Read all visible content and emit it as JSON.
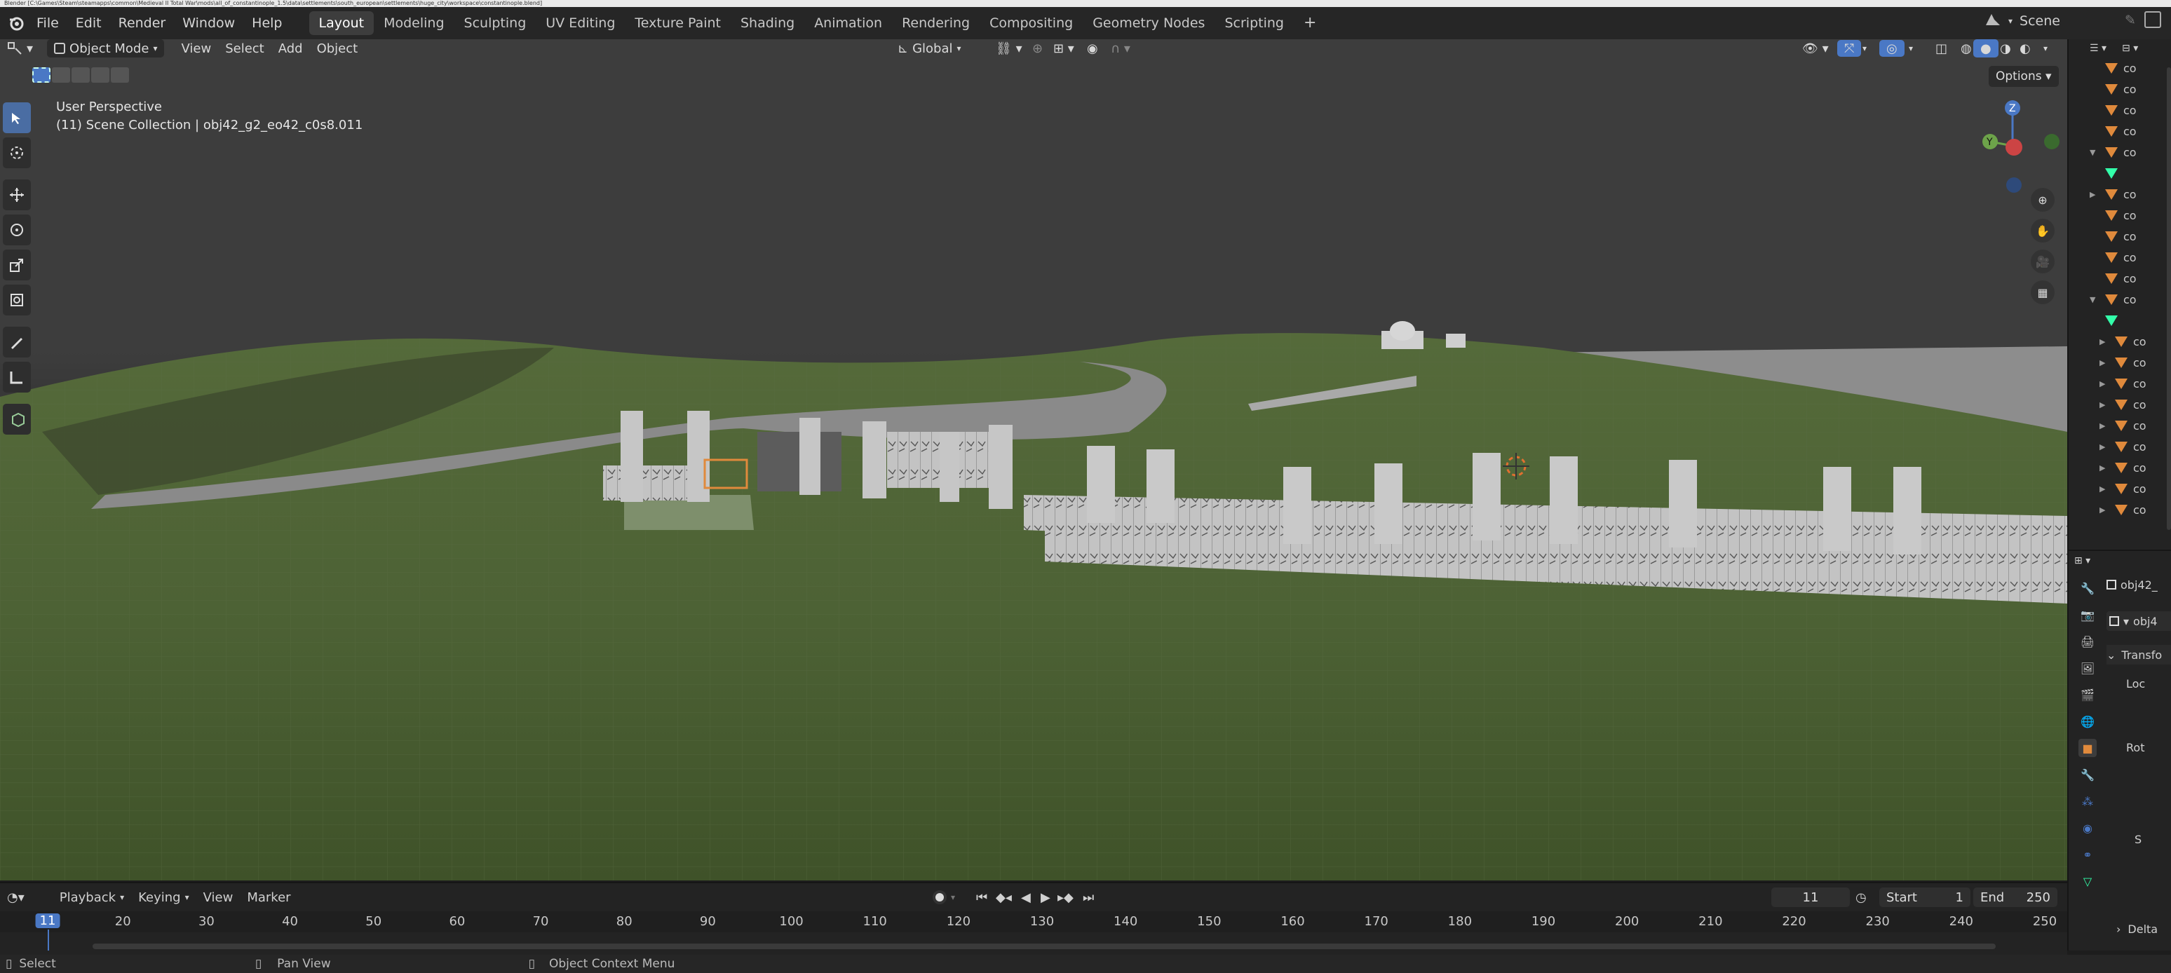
{
  "titlebar": {
    "text": "Blender [C:\\Games\\Steam\\steamapps\\common\\Medieval II Total War\\mods\\all_of_constantinople_1.5\\data\\settlements\\south_european\\settlements\\huge_city\\workspace\\constantinople.blend]"
  },
  "menu": [
    "File",
    "Edit",
    "Render",
    "Window",
    "Help"
  ],
  "workspaces": [
    "Layout",
    "Modeling",
    "Sculpting",
    "UV Editing",
    "Texture Paint",
    "Shading",
    "Animation",
    "Rendering",
    "Compositing",
    "Geometry Nodes",
    "Scripting"
  ],
  "active_workspace": "Layout",
  "scene": {
    "name": "Scene"
  },
  "viewport_header": {
    "mode": "Object Mode",
    "menus": [
      "View",
      "Select",
      "Add",
      "Object"
    ],
    "orientation": "Global",
    "options_label": "Options"
  },
  "viewport": {
    "perspective_label": "User Perspective",
    "collection_label": "(11) Scene Collection | obj42_g2_eo42_c0s8.011",
    "gizmo": {
      "z": "Z",
      "y": "Y"
    }
  },
  "outliner": {
    "row_prefix": "co",
    "rows": 22
  },
  "properties": {
    "object_name": "obj42_",
    "data_name": "obj4",
    "section": "Transfo",
    "location_label": "Loc",
    "rotation_label": "Rot",
    "scale_label": "S",
    "delta_label": "Delta"
  },
  "timeline": {
    "menus": [
      "Playback",
      "Keying",
      "View",
      "Marker"
    ],
    "current_frame": "11",
    "start_label": "Start",
    "start_value": "1",
    "end_label": "End",
    "end_value": "250",
    "ruler_ticks": [
      "11",
      "20",
      "30",
      "40",
      "50",
      "60",
      "70",
      "80",
      "90",
      "100",
      "110",
      "120",
      "130",
      "140",
      "150",
      "160",
      "170",
      "180",
      "190",
      "200",
      "210",
      "220",
      "230",
      "240",
      "250"
    ]
  },
  "statusbar": {
    "select": "Select",
    "pan": "Pan View",
    "context": "Object Context Menu"
  },
  "colors": {
    "accent": "#4a78c5",
    "active_object": "#e08a3c",
    "terrain": "#4b5c33",
    "wall": "#bdbdbd"
  }
}
